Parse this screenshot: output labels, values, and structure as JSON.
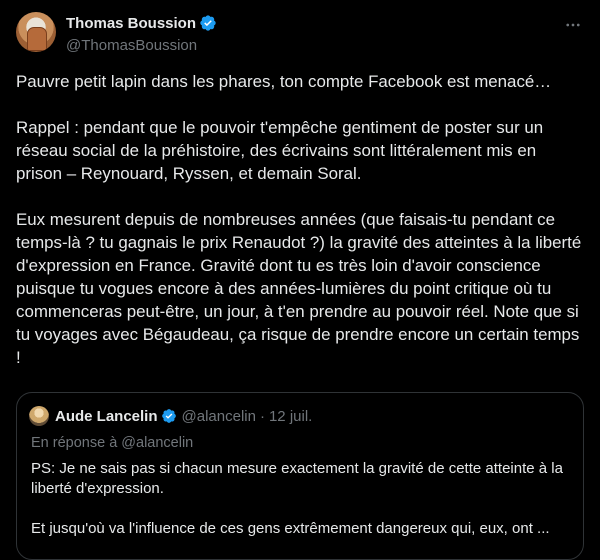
{
  "author": {
    "name": "Thomas Boussion",
    "handle": "@ThomasBoussion",
    "verified": true
  },
  "tweet": {
    "paragraphs": [
      "Pauvre petit lapin dans les phares, ton compte Facebook est menacé…",
      "Rappel : pendant que le pouvoir t'empêche gentiment de poster sur un réseau social de la préhistoire, des écrivains sont littéralement mis en prison – Reynouard, Ryssen, et demain Soral.",
      "Eux mesurent depuis de nombreuses années (que faisais-tu pendant ce temps-là ? tu gagnais le prix Renaudot ?) la gravité des atteintes à la liberté d'expression en France. Gravité dont tu es très loin d'avoir conscience puisque tu vogues encore à des années-lumières du point critique où tu commenceras peut-être, un jour, à t'en prendre au pouvoir réel. Note que si tu voyages avec Bégaudeau, ça risque de prendre encore un certain temps !"
    ]
  },
  "quoted": {
    "name": "Aude Lancelin",
    "handle": "@alancelin",
    "separator": "·",
    "date": "12 juil.",
    "reply_to": "En réponse à @alancelin",
    "paragraphs": [
      "PS: Je ne sais pas si chacun mesure exactement la gravité de cette atteinte à la liberté d'expression.",
      "Et jusqu'où va l'influence de ces gens extrêmement dangereux qui, eux, ont ..."
    ]
  },
  "icons": {
    "verified": "verified-badge-icon",
    "more": "more-options-icon"
  },
  "colors": {
    "background": "#000000",
    "text": "#e7e9ea",
    "secondary": "#71767b",
    "verified": "#1d9bf0",
    "border": "#2f3336"
  }
}
